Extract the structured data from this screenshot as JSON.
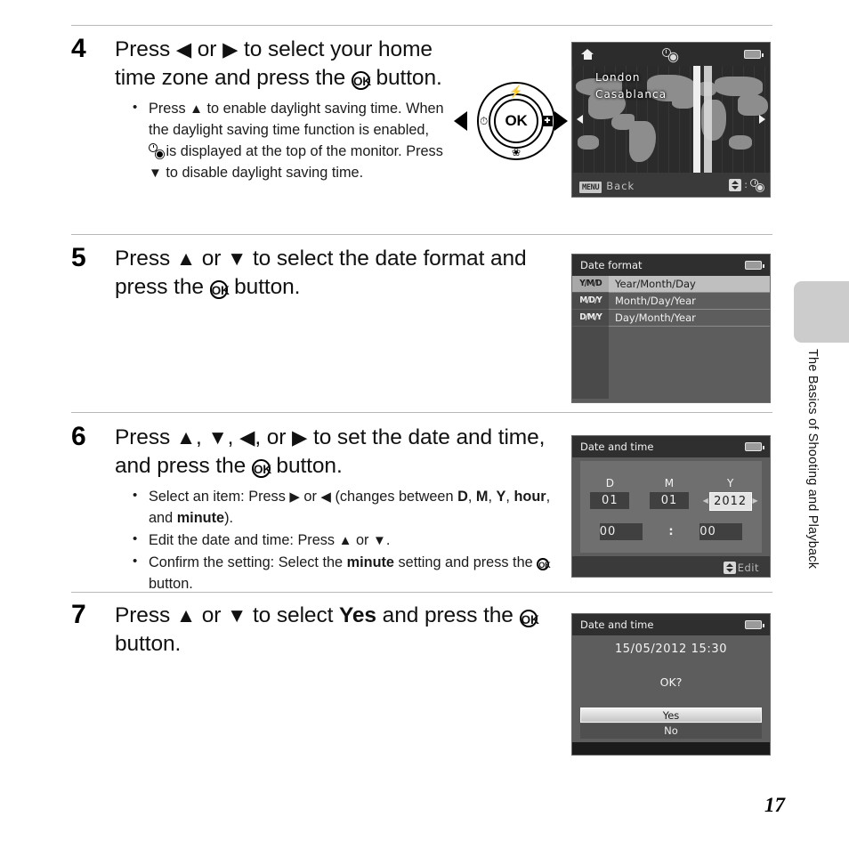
{
  "page": {
    "number": "17",
    "chapter_tab_label": "The Basics of Shooting and Playback"
  },
  "steps": [
    {
      "number": "4",
      "heading_parts": [
        "Press ",
        "◀",
        " or ",
        "▶",
        " to select your home time zone and press the ",
        "OK",
        " button."
      ],
      "heading_plain": "Press ◀ or ▶ to select your home time zone and press the OK button.",
      "bullets": [
        "Press ▲ to enable daylight saving time. When the daylight saving time function is enabled, ☀ is displayed at the top of the monitor. Press ▼ to disable daylight saving time."
      ]
    },
    {
      "number": "5",
      "heading_plain": "Press ▲ or ▼ to select the date format and press the OK button.",
      "bullets": []
    },
    {
      "number": "6",
      "heading_plain": "Press ▲, ▼, ◀, or ▶ to set the date and time, and press the OK button.",
      "bullets": [
        "Select an item: Press ▶ or ◀ (changes between D, M, Y, hour, and minute).",
        "Edit the date and time: Press ▲ or ▼.",
        "Confirm the setting: Select the minute setting and press the OK button."
      ]
    },
    {
      "number": "7",
      "heading_plain": "Press ▲ or ▼ to select Yes and press the OK button.",
      "bullets": []
    }
  ],
  "multi_selector": {
    "center_label": "OK",
    "top_icon": "flash-icon",
    "bottom_icon": "macro-flower-icon",
    "left_icon": "self-timer-icon",
    "right_icon": "exposure-compensation-icon",
    "left_arrow": "left-arrow-icon",
    "right_arrow": "right-arrow-icon"
  },
  "screens": {
    "world_time": {
      "home_icon": "home-icon",
      "dst_icon": "daylight-saving-icon",
      "battery_icon": "battery-icon",
      "cities": [
        "London",
        "Casablanca"
      ],
      "back_badge": "MENU",
      "back_label": "Back",
      "dst_hint": ":"
    },
    "date_format": {
      "title": "Date format",
      "battery_icon": "battery-icon",
      "options": [
        {
          "tag": "Y/M/D",
          "label": "Year/Month/Day",
          "selected": true
        },
        {
          "tag": "M/D/Y",
          "label": "Month/Day/Year",
          "selected": false
        },
        {
          "tag": "D/M/Y",
          "label": "Day/Month/Year",
          "selected": false
        }
      ]
    },
    "date_time": {
      "title": "Date and time",
      "battery_icon": "battery-icon",
      "fields": [
        {
          "caption": "D",
          "value": "01",
          "active": false
        },
        {
          "caption": "M",
          "value": "01",
          "active": false
        },
        {
          "caption": "Y",
          "value": "2012",
          "active": true
        }
      ],
      "hour": "00",
      "separator": ":",
      "minute": "00",
      "footer_label": "Edit"
    },
    "confirm": {
      "title": "Date and time",
      "battery_icon": "battery-icon",
      "datetime": "15/05/2012  15:30",
      "question": "OK?",
      "yes_label": "Yes",
      "no_label": "No"
    }
  },
  "colors": {
    "rule": "#b9b9b9",
    "tab_gray": "#cccccc",
    "lcd_title_bar": "#2f2f2f",
    "lcd_body": "#5d5d5d",
    "selected_row": "#bfbfbf"
  }
}
